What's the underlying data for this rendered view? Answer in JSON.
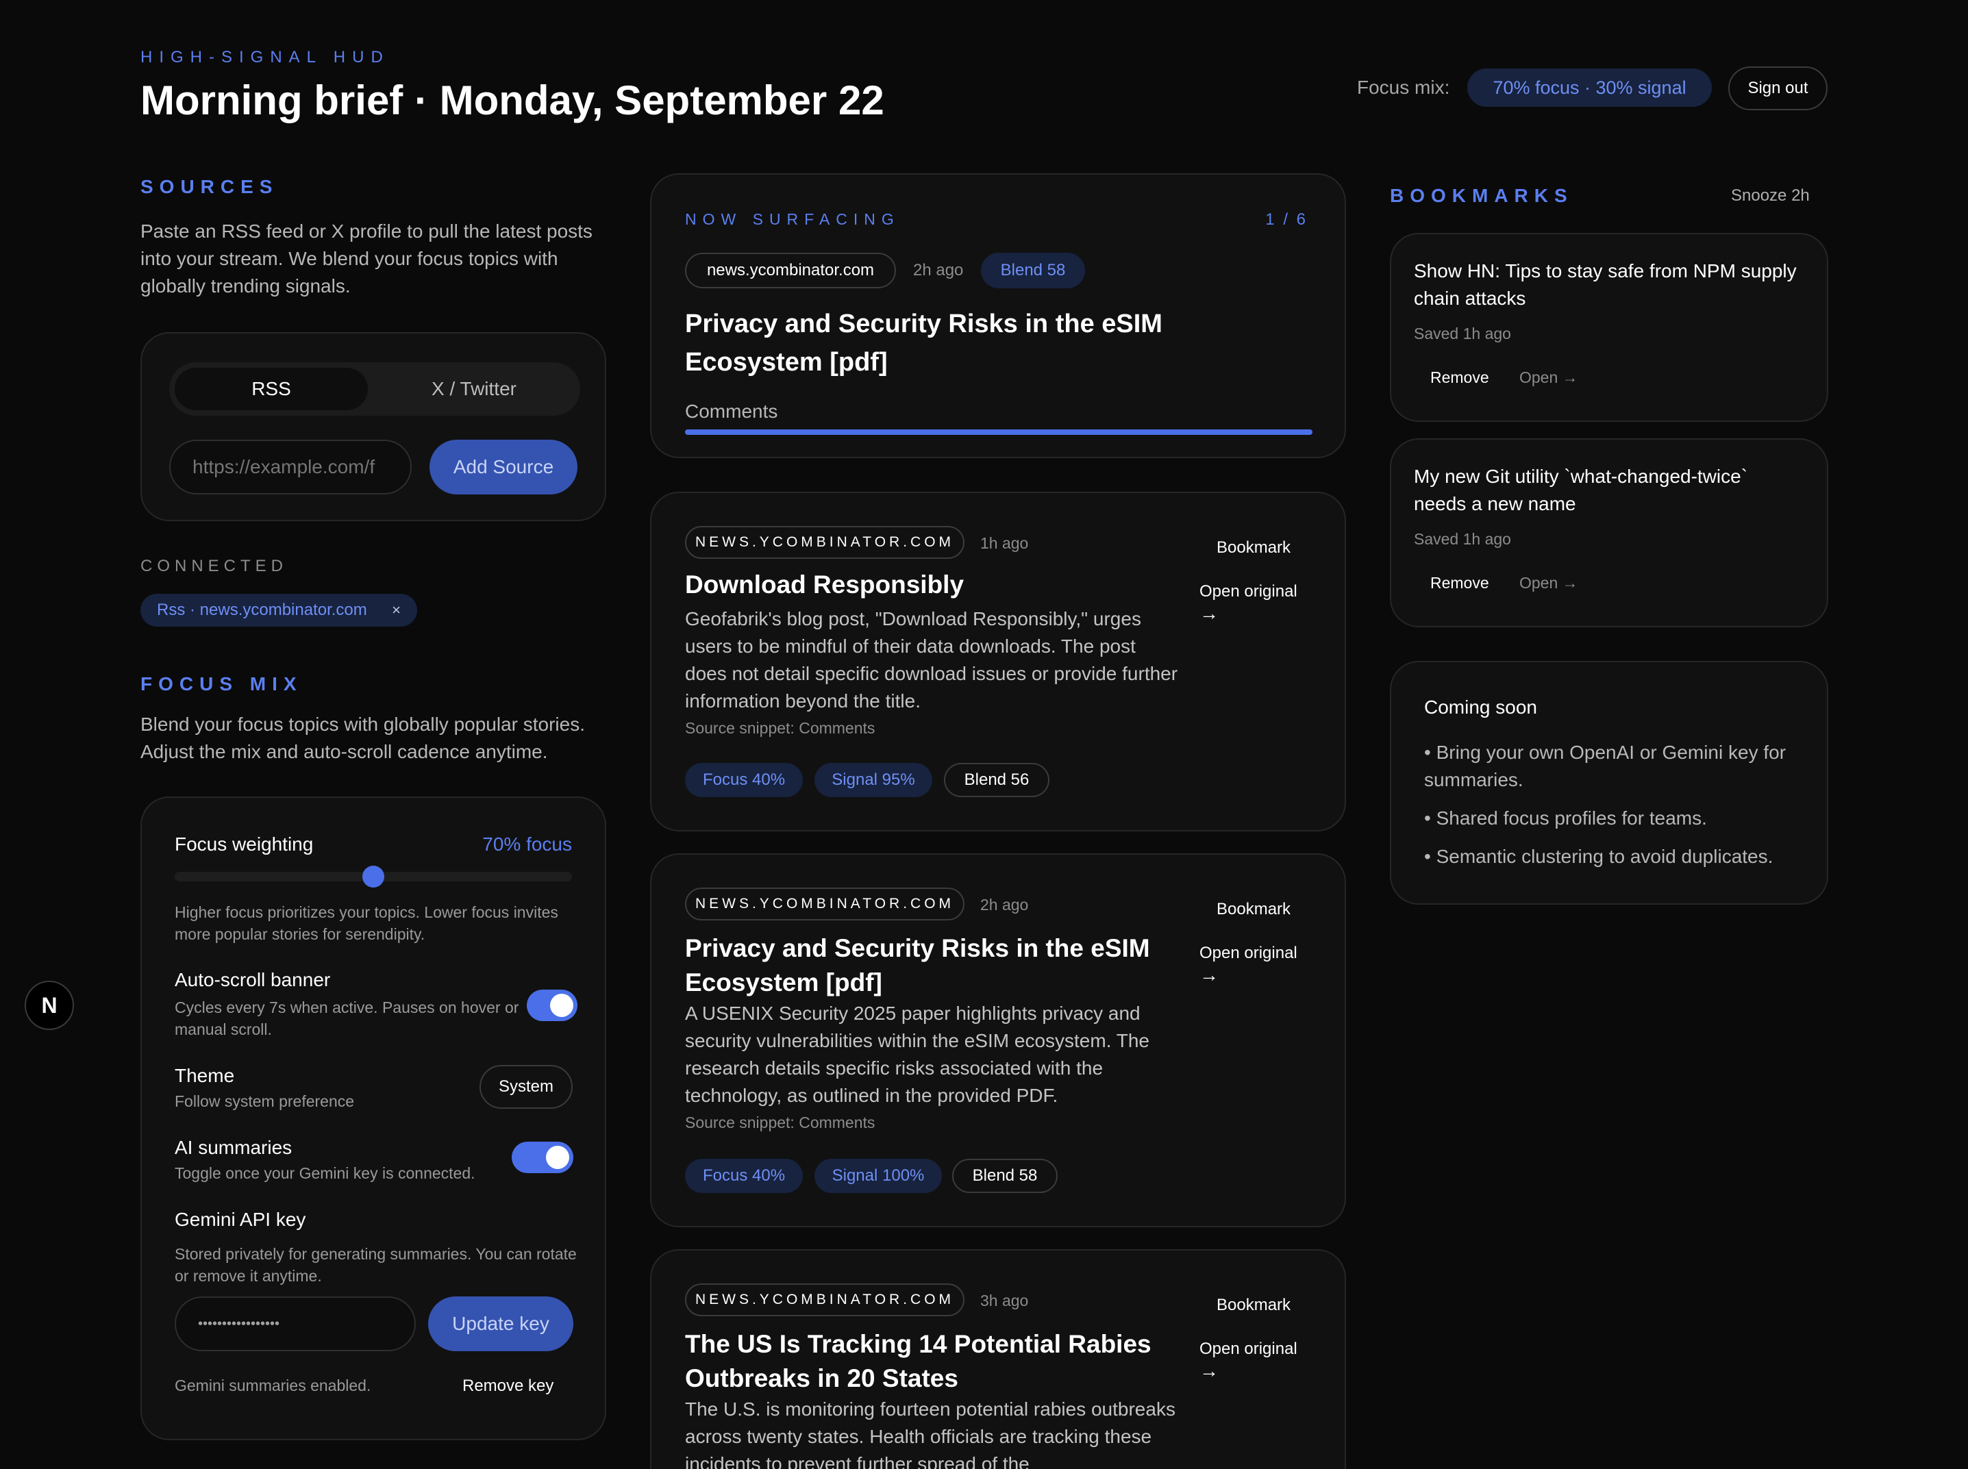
{
  "header": {
    "kicker": "HIGH-SIGNAL HUD",
    "title": "Morning brief · Monday, September 22",
    "focus_mix_label": "Focus mix:",
    "focus_mix_value": "70% focus · 30% signal",
    "sign_out": "Sign out"
  },
  "sources": {
    "heading": "SOURCES",
    "description": "Paste an RSS feed or X profile to pull the latest posts into your stream. We blend your focus topics with globally trending signals.",
    "tabs": [
      "RSS",
      "X / Twitter"
    ],
    "input_placeholder": "https://example.com/f",
    "add_button": "Add Source",
    "connected_heading": "CONNECTED",
    "connected_chip": "Rss · news.ycombinator.com",
    "chip_remove": "×"
  },
  "focus_mix": {
    "heading": "FOCUS MIX",
    "description": "Blend your focus topics with globally popular stories. Adjust the mix and auto-scroll cadence anytime.",
    "weighting_label": "Focus weighting",
    "weighting_value": "70% focus",
    "slider_fraction": 0.5,
    "weighting_help": "Higher focus prioritizes your topics. Lower focus invites more popular stories for serendipity.",
    "autoscroll_label": "Auto-scroll banner",
    "autoscroll_help": "Cycles every 7s when active. Pauses on hover or manual scroll.",
    "theme_label": "Theme",
    "theme_help": "Follow system preference",
    "theme_value": "System",
    "ai_label": "AI summaries",
    "ai_help": "Toggle once your Gemini key is connected.",
    "gemini_label": "Gemini API key",
    "gemini_help": "Stored privately for generating summaries. You can rotate or remove it anytime.",
    "gemini_masked": "•••••••••••••••••",
    "update_button": "Update key",
    "gemini_status": "Gemini summaries enabled.",
    "remove_key": "Remove key"
  },
  "now_surfacing": {
    "kicker": "NOW SURFACING",
    "counter": "1 / 6",
    "source": "news.ycombinator.com",
    "age": "2h ago",
    "blend": "Blend 58",
    "title": "Privacy and Security Risks in the eSIM Ecosystem [pdf]",
    "sub": "Comments",
    "progress_fraction": 1.0
  },
  "feed": [
    {
      "source": "NEWS.YCOMBINATOR.COM",
      "age": "1h ago",
      "title": "Download Responsibly",
      "summary": "Geofabrik's blog post, \"Download Responsibly,\" urges users to be mindful of their data downloads. The post does not detail specific download issues or provide further information beyond the title.",
      "snippet": "Source snippet: Comments",
      "focus": "Focus 40%",
      "signal": "Signal 95%",
      "blend": "Blend 56",
      "bookmark": "Bookmark",
      "open": "Open original",
      "arrow": "→"
    },
    {
      "source": "NEWS.YCOMBINATOR.COM",
      "age": "2h ago",
      "title": "Privacy and Security Risks in the eSIM Ecosystem [pdf]",
      "summary": "A USENIX Security 2025 paper highlights privacy and security vulnerabilities within the eSIM ecosystem. The research details specific risks associated with the technology, as outlined in the provided PDF.",
      "snippet": "Source snippet: Comments",
      "focus": "Focus 40%",
      "signal": "Signal 100%",
      "blend": "Blend 58",
      "bookmark": "Bookmark",
      "open": "Open original",
      "arrow": "→"
    },
    {
      "source": "NEWS.YCOMBINATOR.COM",
      "age": "3h ago",
      "title": "The US Is Tracking 14 Potential Rabies Outbreaks in 20 States",
      "summary": "The U.S. is monitoring fourteen potential rabies outbreaks across twenty states. Health officials are tracking these incidents to prevent further spread of the",
      "bookmark": "Bookmark",
      "open": "Open original",
      "arrow": "→"
    }
  ],
  "bookmarks": {
    "heading": "BOOKMARKS",
    "snooze": "Snooze 2h",
    "items": [
      {
        "title": "Show HN: Tips to stay safe from NPM supply chain attacks",
        "saved": "Saved 1h ago",
        "remove": "Remove",
        "open": "Open →"
      },
      {
        "title": "My new Git utility `what-changed-twice` needs a new name",
        "saved": "Saved 1h ago",
        "remove": "Remove",
        "open": "Open →"
      }
    ]
  },
  "coming_soon": {
    "title": "Coming soon",
    "items": [
      "• Bring your own OpenAI or Gemini key for summaries.",
      "• Shared focus profiles for teams.",
      "• Semantic clustering to avoid duplicates."
    ]
  },
  "floating_badge": "N",
  "colors": {
    "accent": "#4a6fe8",
    "background": "#0a0a0a",
    "card": "#111111"
  }
}
